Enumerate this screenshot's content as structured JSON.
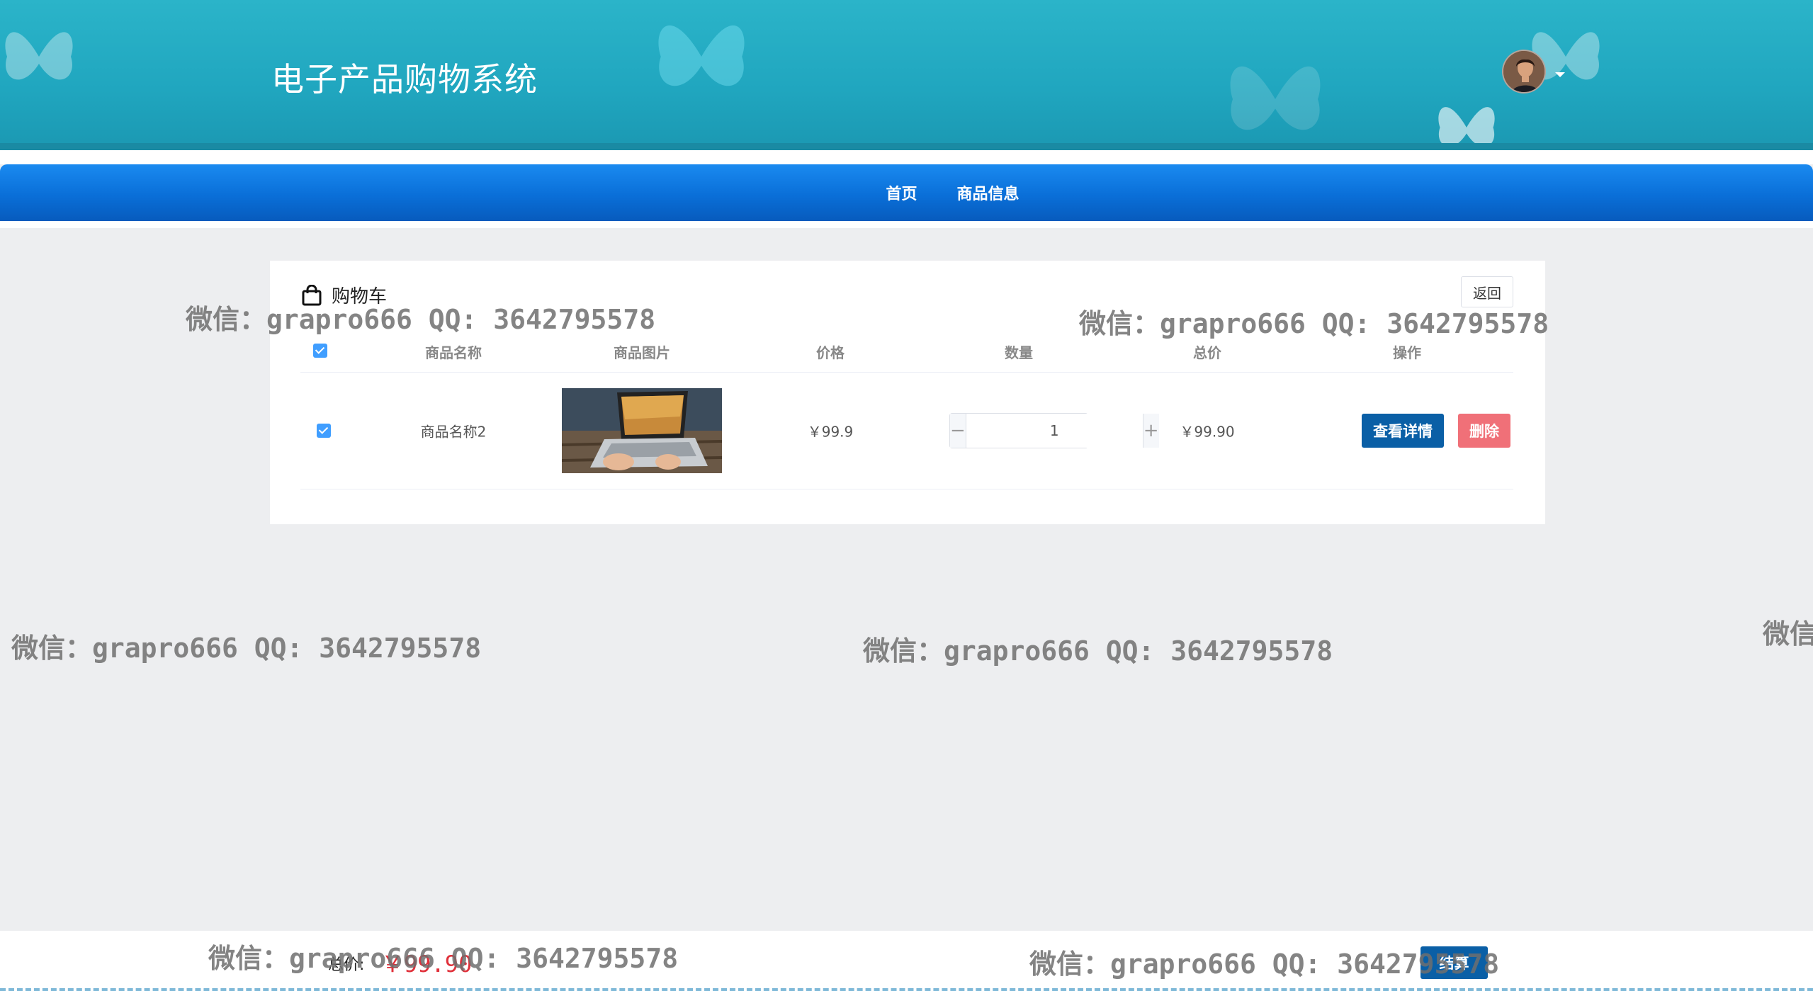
{
  "header": {
    "site_title": "电子产品购物系统"
  },
  "nav": {
    "items": [
      {
        "label": "首页"
      },
      {
        "label": "商品信息"
      }
    ]
  },
  "cart": {
    "title": "购物车",
    "back_label": "返回",
    "columns": [
      "商品名称",
      "商品图片",
      "价格",
      "数量",
      "总价",
      "操作"
    ],
    "rows": [
      {
        "checked": true,
        "name": "商品名称2",
        "price": "￥99.9",
        "quantity": "1",
        "subtotal": "￥99.90",
        "detail_label": "查看详情",
        "delete_label": "删除"
      }
    ]
  },
  "footer": {
    "total_label": "总价:",
    "total_value": "￥99.90",
    "checkout_label": "结算"
  },
  "watermarks": {
    "text": "微信：grapro666 QQ: 3642795578",
    "partial": "微信"
  },
  "colors": {
    "header_bg": "#20a6bf",
    "nav_bg": "#0a6fd8",
    "primary_button": "#0a5fa6",
    "danger_button": "#f07078",
    "total_price": "#e0303a",
    "checkbox": "#409eff"
  }
}
